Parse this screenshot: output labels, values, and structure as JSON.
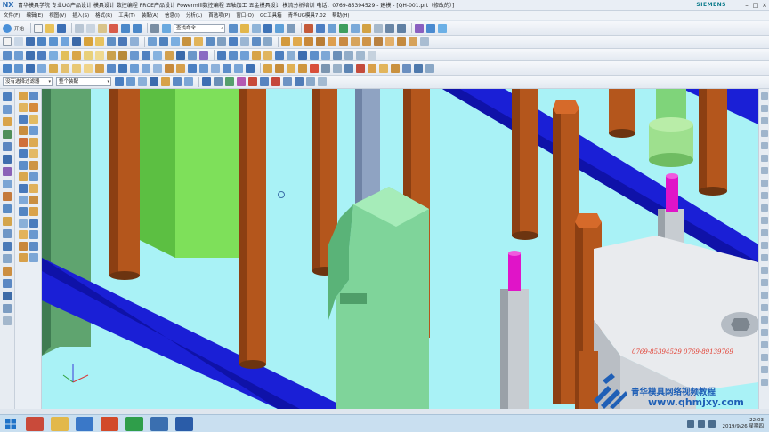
{
  "window": {
    "app_logo": "NX",
    "title": "青华模具学院 专业UG产品设计 模具设计 数控编程 PROE产品设计 Powermill数控编程 五轴加工 五金模具设计 模流分析培训 电话：0769-85394529 - 建模 - [QH-001.prt（修改的）]",
    "brand": "SIEMENS",
    "controls": [
      "–",
      "□",
      "×"
    ]
  },
  "menubar": {
    "items": [
      "文件(F)",
      "编辑(E)",
      "视图(V)",
      "插入(S)",
      "格式(R)",
      "工具(T)",
      "装配(A)",
      "信息(I)",
      "分析(L)",
      "首选项(P)",
      "窗口(O)",
      "GC工具箱",
      "青华UG模具7.02",
      "帮助(H)"
    ]
  },
  "toolbar": {
    "start_label": "开始",
    "command_search": "查找命令",
    "selection_filter": "没有选择过滤器",
    "assembly_scope": "整个装配"
  },
  "viewport": {
    "background": "#a9f2f6",
    "pin_color": "#b4561c",
    "rod_color": "#1a1fd6",
    "block_color": "#7ee05a",
    "slider_color": "#7fd49a",
    "ejector_tip_color": "#e014c8"
  },
  "watermark": {
    "phone": "0769-85394529  0769-89139769",
    "school": "青华模具网络视频教程",
    "url": "www.qhmjxy.com"
  },
  "taskbar": {
    "apps": [
      "start",
      "file-explorer",
      "folder",
      "media",
      "chat",
      "wechat",
      "nx",
      "word"
    ],
    "time": "22:03",
    "date": "2019/9/26 星期四"
  }
}
